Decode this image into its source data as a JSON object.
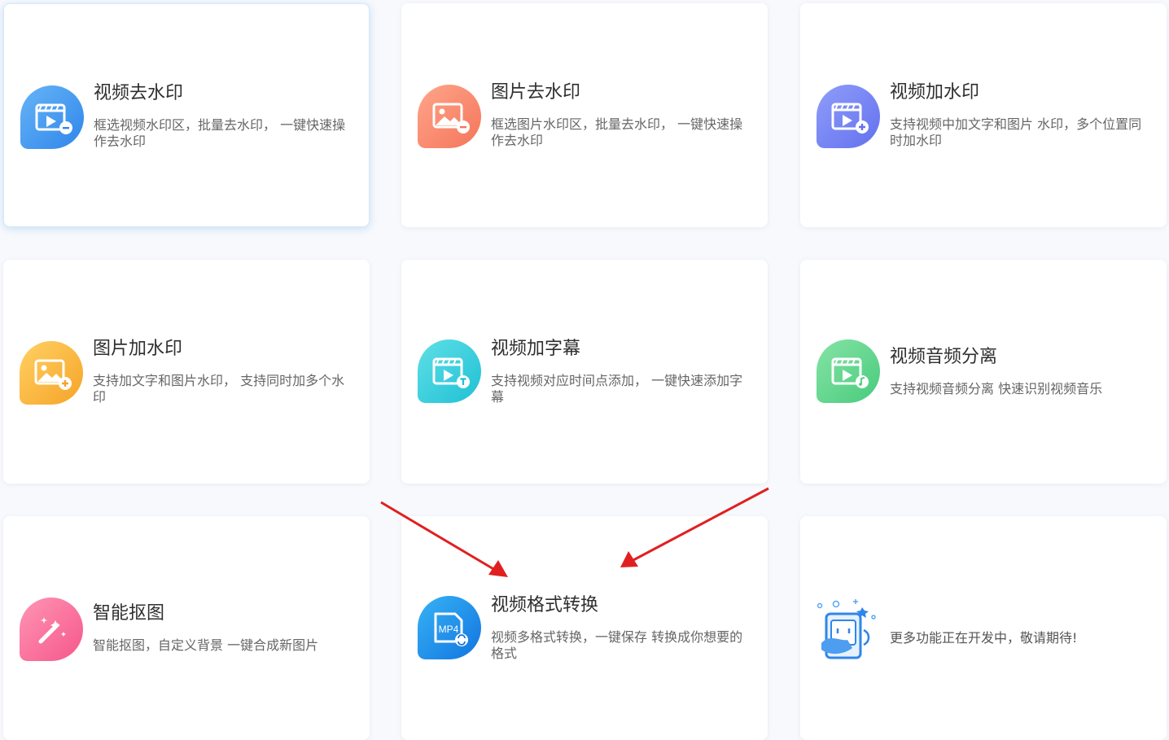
{
  "cards": [
    {
      "title": "视频去水印",
      "desc": "框选视频水印区，批量去水印， 一键快速操作去水印",
      "icon": "video-remove-watermark-icon",
      "color_start": "#66b4f7",
      "color_end": "#2f86ea"
    },
    {
      "title": "图片去水印",
      "desc": "框选图片水印区，批量去水印， 一键快速操作去水印",
      "icon": "image-remove-watermark-icon",
      "color_start": "#ffa58a",
      "color_end": "#f4755a"
    },
    {
      "title": "视频加水印",
      "desc": "支持视频中加文字和图片 水印，多个位置同时加水印",
      "icon": "video-add-watermark-icon",
      "color_start": "#8f9dfb",
      "color_end": "#6371ee"
    },
    {
      "title": "图片加水印",
      "desc": "支持加文字和图片水印， 支持同时加多个水印",
      "icon": "image-add-watermark-icon",
      "color_start": "#ffd163",
      "color_end": "#f6a328"
    },
    {
      "title": "视频加字幕",
      "desc": "支持视频对应时间点添加， 一键快速添加字幕",
      "icon": "video-subtitle-icon",
      "color_start": "#5fe0e6",
      "color_end": "#1fc0d5"
    },
    {
      "title": "视频音频分离",
      "desc": "支持视频音频分离 快速识别视频音乐",
      "icon": "audio-separate-icon",
      "color_start": "#86e3a6",
      "color_end": "#48cb7c"
    },
    {
      "title": "智能抠图",
      "desc": "智能抠图，自定义背景 一键合成新图片",
      "icon": "magic-wand-icon",
      "color_start": "#ff95b5",
      "color_end": "#f5578a"
    },
    {
      "title": "视频格式转换",
      "desc": "视频多格式转换，一键保存 转换成你想要的格式",
      "icon": "mp4-convert-icon",
      "icon_text": "MP4",
      "color_start": "#37b3f5",
      "color_end": "#1274e0"
    },
    {
      "title": "",
      "desc": "",
      "more_text": "更多功能正在开发中，敬请期待!",
      "icon": "more-features-illustration-icon"
    }
  ],
  "colors": {
    "arrow": "#e02020",
    "accent": "#2f86ea"
  }
}
